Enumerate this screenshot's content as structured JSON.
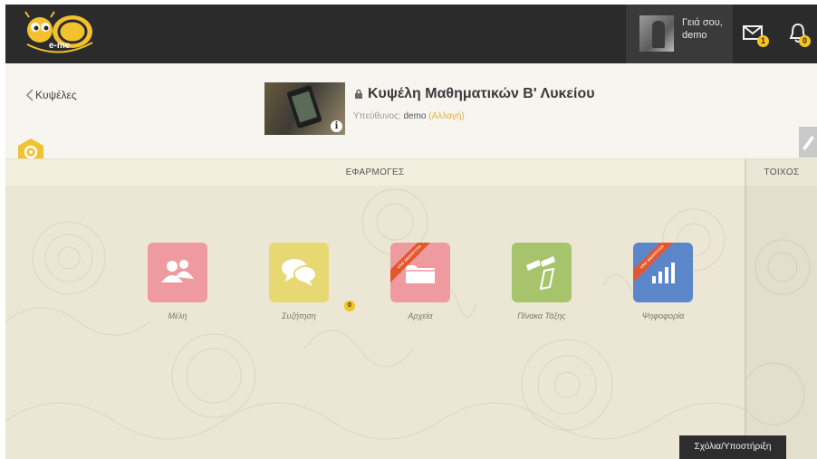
{
  "topbar": {
    "logo_text": "e-me",
    "greeting_line1": "Γειά σου,",
    "greeting_line2": "demo",
    "mail_count": "1",
    "notification_count": "0",
    "icons": [
      "bee-logo-icon",
      "mail-icon",
      "bell-icon"
    ]
  },
  "header": {
    "back_label": "Κυψέλες",
    "title": "Κυψέλη Μαθηματικών Β' Λυκείου",
    "responsible_label": "Υπεύθυνος:",
    "responsible_name": "demo",
    "change_label": "(Αλλαγή)",
    "info_glyph": "i"
  },
  "sections": {
    "apps_title": "ΕΦΑΡΜΟΓΕΣ",
    "wall_title": "ΤΟΙΧΟΣ"
  },
  "apps": [
    {
      "label": "Μέλη",
      "color": "#ee9a9f",
      "icon": "members-icon",
      "ribbon": ""
    },
    {
      "label": "Συζήτηση",
      "color": "#e7d873",
      "icon": "chat-icon",
      "ribbon": ""
    },
    {
      "label": "Αρχεία",
      "color": "#ee9a9f",
      "icon": "folder-icon",
      "ribbon": "ΥΠΟ ΑΝΑΠΤΥΞΗ"
    },
    {
      "label": "Πίνακα Τάξης",
      "color": "#a7c46c",
      "icon": "class-board-icon",
      "ribbon": ""
    },
    {
      "label": "Ψηφοφορία",
      "color": "#5b86c9",
      "icon": "bar-chart-icon",
      "ribbon": "ΥΠΟ ΑΝΑΠΤΥΞΗ"
    }
  ],
  "discussion_badge": "0",
  "support_label": "Σχόλια/Υποστήριξη",
  "colors": {
    "topbar": "#2b2b2b",
    "accent_yellow": "#f4c51e",
    "ribbon": "#e4572e"
  }
}
